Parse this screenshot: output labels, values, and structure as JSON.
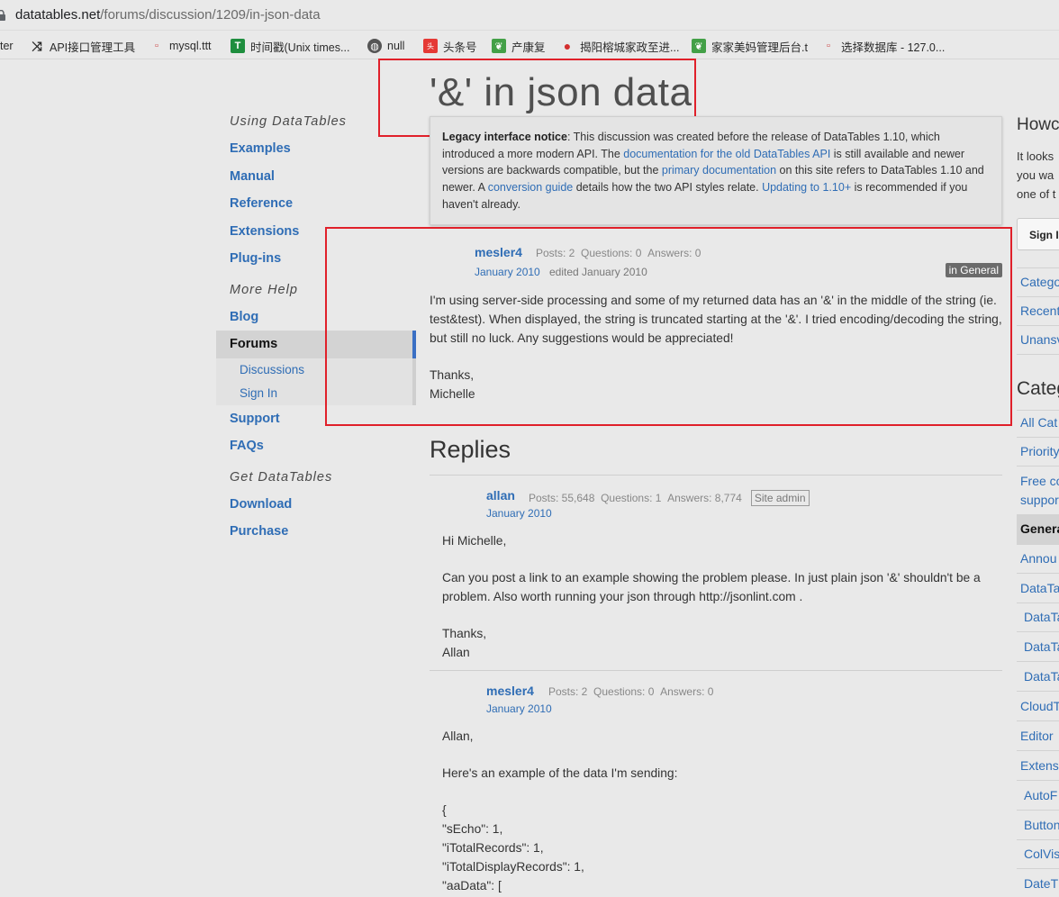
{
  "browser": {
    "url_domain": "datatables.net",
    "url_path": "/forums/discussion/1209/in-json-data",
    "bookmarks": [
      {
        "label": "ter",
        "icon": "none"
      },
      {
        "label": "API接口管理工具",
        "icon": "shuffle-icon"
      },
      {
        "label": "mysql.ttt",
        "icon": "page-icon"
      },
      {
        "label": "时间戳(Unix times...",
        "icon": "t-icon"
      },
      {
        "label": "null",
        "icon": "globe-icon"
      },
      {
        "label": "头条号",
        "icon": "toutiao-icon"
      },
      {
        "label": "产康复",
        "icon": "leaf-icon"
      },
      {
        "label": "揭阳榕城家政至进...",
        "icon": "pin-icon"
      },
      {
        "label": "家家美妈管理后台.t",
        "icon": "leaf-icon"
      },
      {
        "label": "选择数据库 - 127.0...",
        "icon": "page-icon"
      }
    ]
  },
  "sidebar": {
    "heading_using": "Using DataTables",
    "examples": "Examples",
    "manual": "Manual",
    "reference": "Reference",
    "extensions": "Extensions",
    "plugins": "Plug-ins",
    "heading_more": "More Help",
    "blog": "Blog",
    "forums": "Forums",
    "discussions": "Discussions",
    "sign_in": "Sign In",
    "support": "Support",
    "faqs": "FAQs",
    "heading_get": "Get DataTables",
    "download": "Download",
    "purchase": "Purchase"
  },
  "page": {
    "title": "'&' in json data"
  },
  "legacy": {
    "bold": "Legacy interface notice",
    "t1": ": This discussion was created before the release of DataTables 1.10, which introduced a more modern API. The ",
    "link1": "documentation for the old DataTables API",
    "t2": " is still available and newer versions are backwards compatible, but the ",
    "link2": "primary documentation",
    "t3": " on this site refers to DataTables 1.10 and newer. A ",
    "link3": "conversion guide",
    "t4": " details how the two API styles relate. ",
    "link4": "Updating to 1.10+",
    "t5": " is recommended if you haven't already."
  },
  "question": {
    "author": "mesler4",
    "posts": "Posts: 2",
    "questions": "Questions: 0",
    "answers": "Answers: 0",
    "date": "January 2010",
    "edited": "edited January 2010",
    "category": "in General",
    "p1": "I'm using server-side processing and some of my returned data has an '&' in the middle of the string (ie. test&test). When displayed, the string is truncated starting at the '&'. I tried encoding/decoding the string, but still no luck. Any suggestions would be appreciated!",
    "p2a": "Thanks,",
    "p2b": "Michelle"
  },
  "replies": {
    "heading": "Replies",
    "reply1": {
      "author": "allan",
      "posts": "Posts: 55,648",
      "questions": "Questions: 1",
      "answers": "Answers: 8,774",
      "badge": "Site admin",
      "date": "January 2010",
      "p1": "Hi Michelle,",
      "p2": "Can you post a link to an example showing the problem please. In just plain json '&' shouldn't be a problem. Also worth running your json through http://jsonlint.com .",
      "p3a": "Thanks,",
      "p3b": "Allan"
    },
    "reply2": {
      "author": "mesler4",
      "posts": "Posts: 2",
      "questions": "Questions: 0",
      "answers": "Answers: 0",
      "date": "January 2010",
      "p1": "Allan,",
      "p2": "Here's an example of the data I'm sending:",
      "code1": "{",
      "code2": "\"sEcho\": 1,",
      "code3": "\"iTotalRecords\": 1,",
      "code4": "\"iTotalDisplayRecords\": 1,",
      "code5": "\"aaData\": ["
    }
  },
  "right": {
    "title1": "Howc",
    "text1": "It looks",
    "text2": "you wa",
    "text3": "one of t",
    "sign_btn": "Sign I",
    "cat_link": "Catego",
    "recent": "Recent",
    "unans": "Unansv",
    "title2": "Categ",
    "items": [
      "All Cat",
      "Priority",
      "Free co",
      "suppor",
      "Genera",
      "Annou",
      "DataTa",
      "DataTa",
      "DataTa",
      "DataTa",
      "CloudT",
      "Editor",
      "Extens",
      "AutoF",
      "Button",
      "ColVis",
      "DateT"
    ]
  }
}
